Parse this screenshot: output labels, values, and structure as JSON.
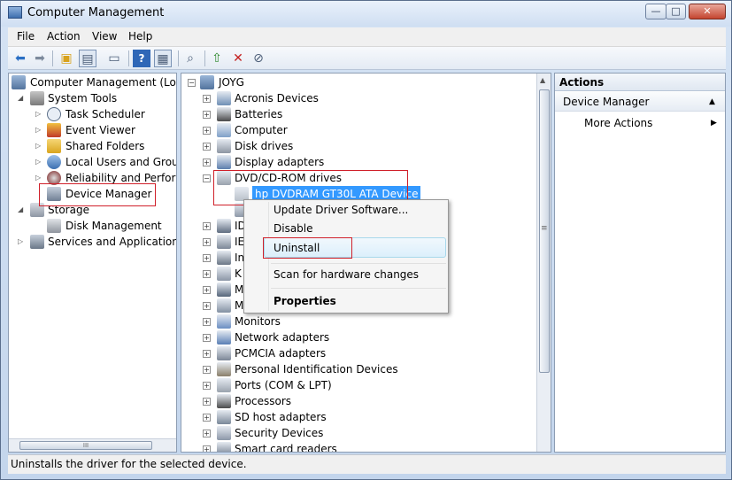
{
  "window": {
    "title": "Computer Management",
    "min": "—",
    "max": "□",
    "close": "✕"
  },
  "menu": {
    "file": "File",
    "action": "Action",
    "view": "View",
    "help": "Help"
  },
  "toolbar": {
    "icons": [
      "back-icon",
      "forward-icon",
      "up-folder-icon",
      "show-tree-icon",
      "properties-icon",
      "help-icon",
      "console-view-icon",
      "scan-hardware-icon",
      "update-driver-icon",
      "uninstall-icon",
      "disable-icon"
    ]
  },
  "left_tree": [
    {
      "label": "Computer Management (Local",
      "level": 0,
      "toggle": ""
    },
    {
      "label": "System Tools",
      "level": 1,
      "toggle": "open"
    },
    {
      "label": "Task Scheduler",
      "level": 2,
      "toggle": "closed"
    },
    {
      "label": "Event Viewer",
      "level": 2,
      "toggle": "closed"
    },
    {
      "label": "Shared Folders",
      "level": 2,
      "toggle": "closed"
    },
    {
      "label": "Local Users and Groups",
      "level": 2,
      "toggle": "closed"
    },
    {
      "label": "Reliability and Performa",
      "level": 2,
      "toggle": "closed"
    },
    {
      "label": "Device Manager",
      "level": 2,
      "toggle": ""
    },
    {
      "label": "Storage",
      "level": 1,
      "toggle": "open"
    },
    {
      "label": "Disk Management",
      "level": 2,
      "toggle": ""
    },
    {
      "label": "Services and Applications",
      "level": 1,
      "toggle": "closed"
    }
  ],
  "left_scroll_grip": "III",
  "device_tree": {
    "root": "JOYG",
    "items": [
      {
        "label": "Acronis Devices",
        "toggle": "+"
      },
      {
        "label": "Batteries",
        "toggle": "+"
      },
      {
        "label": "Computer",
        "toggle": "+"
      },
      {
        "label": "Disk drives",
        "toggle": "+"
      },
      {
        "label": "Display adapters",
        "toggle": "+"
      },
      {
        "label": "DVD/CD-ROM drives",
        "toggle": "−"
      },
      {
        "label": "hp DVDRAM GT30L ATA Device",
        "toggle": "",
        "child": true,
        "selected": true
      },
      {
        "label": "",
        "toggle": "",
        "child": true
      },
      {
        "label": "ID",
        "toggle": "+"
      },
      {
        "label": "IE",
        "toggle": "+"
      },
      {
        "label": "In",
        "toggle": "+"
      },
      {
        "label": "K",
        "toggle": "+"
      },
      {
        "label": "M",
        "toggle": "+"
      },
      {
        "label": "M",
        "toggle": "+"
      },
      {
        "label": "Monitors",
        "toggle": "+"
      },
      {
        "label": "Network adapters",
        "toggle": "+"
      },
      {
        "label": "PCMCIA adapters",
        "toggle": "+"
      },
      {
        "label": "Personal Identification Devices",
        "toggle": "+"
      },
      {
        "label": "Ports (COM & LPT)",
        "toggle": "+"
      },
      {
        "label": "Processors",
        "toggle": "+"
      },
      {
        "label": "SD host adapters",
        "toggle": "+"
      },
      {
        "label": "Security Devices",
        "toggle": "+"
      },
      {
        "label": "Smart card readers",
        "toggle": "+"
      }
    ]
  },
  "center_scroll_grip": "≡",
  "context_menu": {
    "update": "Update Driver Software...",
    "disable": "Disable",
    "uninstall": "Uninstall",
    "scan": "Scan for hardware changes",
    "properties": "Properties"
  },
  "actions": {
    "header": "Actions",
    "section": "Device Manager",
    "more": "More Actions",
    "collapse_glyph": "▲",
    "more_glyph": "▶"
  },
  "status": "Uninstalls the driver for the selected device.",
  "colors": {
    "selection": "#3399ff",
    "annotation": "#d0202a"
  }
}
